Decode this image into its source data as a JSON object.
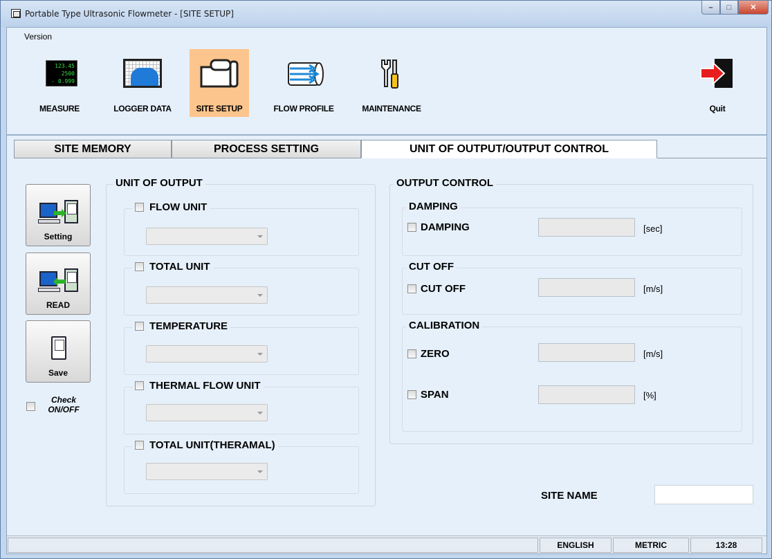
{
  "window": {
    "title": "Portable Type Ultrasonic Flowmeter - [SITE SETUP]",
    "minimize_glyph": "–",
    "maximize_glyph": "□",
    "close_glyph": "✕"
  },
  "menu": {
    "version": "Version"
  },
  "toolbar": {
    "measure_label": "MEASURE",
    "measure_display": [
      "123.45",
      "2500",
      "- 0.999"
    ],
    "logger_label": "LOGGER DATA",
    "site_setup_label": "SITE SETUP",
    "site_setup_active": true,
    "flow_profile_label": "FLOW PROFILE",
    "maintenance_label": "MAINTENANCE",
    "quit_label": "Quit"
  },
  "tabs": {
    "site_memory": "SITE MEMORY",
    "process_setting": "PROCESS SETTING",
    "unit_output": "UNIT OF OUTPUT/OUTPUT CONTROL",
    "active": "unit_output"
  },
  "actions": {
    "setting_label": "Setting",
    "read_label": "READ",
    "save_label": "Save",
    "check_label_line1": "Check",
    "check_label_line2": "ON/OFF",
    "check_checked": false
  },
  "unit_of_output": {
    "title": "UNIT OF OUTPUT",
    "fields": [
      {
        "label": "FLOW UNIT",
        "checked": false,
        "value": ""
      },
      {
        "label": "TOTAL UNIT",
        "checked": false,
        "value": ""
      },
      {
        "label": "TEMPERATURE",
        "checked": false,
        "value": ""
      },
      {
        "label": "THERMAL FLOW UNIT",
        "checked": false,
        "value": ""
      },
      {
        "label": "TOTAL UNIT(THERAMAL)",
        "checked": false,
        "value": ""
      }
    ]
  },
  "output_control": {
    "title": "OUTPUT CONTROL",
    "damping": {
      "group": "DAMPING",
      "label": "DAMPING",
      "unit": "[sec]",
      "value": ""
    },
    "cutoff": {
      "group": "CUT OFF",
      "label": "CUT OFF",
      "unit": "[m/s]",
      "value": ""
    },
    "calibration": {
      "group": "CALIBRATION",
      "zero": {
        "label": "ZERO",
        "unit": "[m/s]",
        "value": ""
      },
      "span": {
        "label": "SPAN",
        "unit": "[%]",
        "value": ""
      }
    }
  },
  "site_name": {
    "label": "SITE NAME",
    "value": ""
  },
  "status": {
    "language": "ENGLISH",
    "units": "METRIC",
    "time": "13:28"
  },
  "colors": {
    "active_tool": "#fcc58d",
    "client_bg": "#e6f0fa",
    "frame": "#c2d7ee"
  }
}
